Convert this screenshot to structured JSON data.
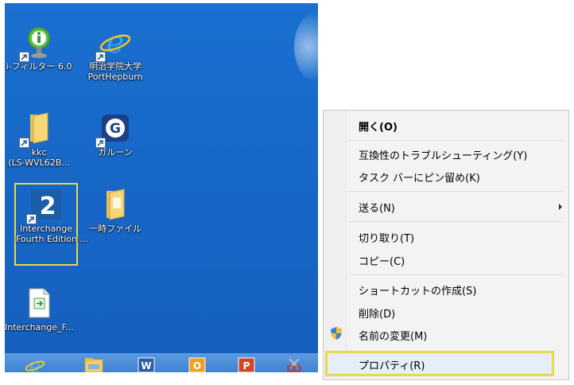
{
  "desktop": {
    "icons": [
      {
        "label": "i-フィルター 6.0",
        "icon": "i-filter-icon"
      },
      {
        "label": "明治学院大学",
        "label2": "PortHepburn",
        "icon": "internet-explorer-icon"
      },
      {
        "label": "kkc",
        "label2": "(LS-WVL62B...",
        "icon": "folder-icon"
      },
      {
        "label": "ガルーン",
        "icon": "garoon-icon"
      },
      {
        "label": "Interchange",
        "label2": "Fourth Edition ...",
        "icon": "interchange-2-icon"
      },
      {
        "label": "一時ファイル",
        "icon": "folder-icon"
      },
      {
        "label": "Interchange_F...",
        "icon": "file-icon"
      }
    ],
    "taskbar": [
      "internet-explorer-icon",
      "file-explorer-icon",
      "word-icon",
      "outlook-icon",
      "powerpoint-icon",
      "snipping-tool-icon"
    ],
    "colors": {
      "background": "#1766c6",
      "highlight_border": "#e8d84a"
    }
  },
  "context_menu": {
    "items": [
      {
        "label": "開く(O)"
      },
      {
        "label": "互換性のトラブルシューティング(Y)"
      },
      {
        "label": "タスク バーにピン留め(K)"
      },
      {
        "label": "送る(N)"
      },
      {
        "label": "切り取り(T)"
      },
      {
        "label": "コピー(C)"
      },
      {
        "label": "ショートカットの作成(S)"
      },
      {
        "label": "削除(D)"
      },
      {
        "label": "名前の変更(M)"
      },
      {
        "label": "プロパティ(R)"
      }
    ]
  }
}
